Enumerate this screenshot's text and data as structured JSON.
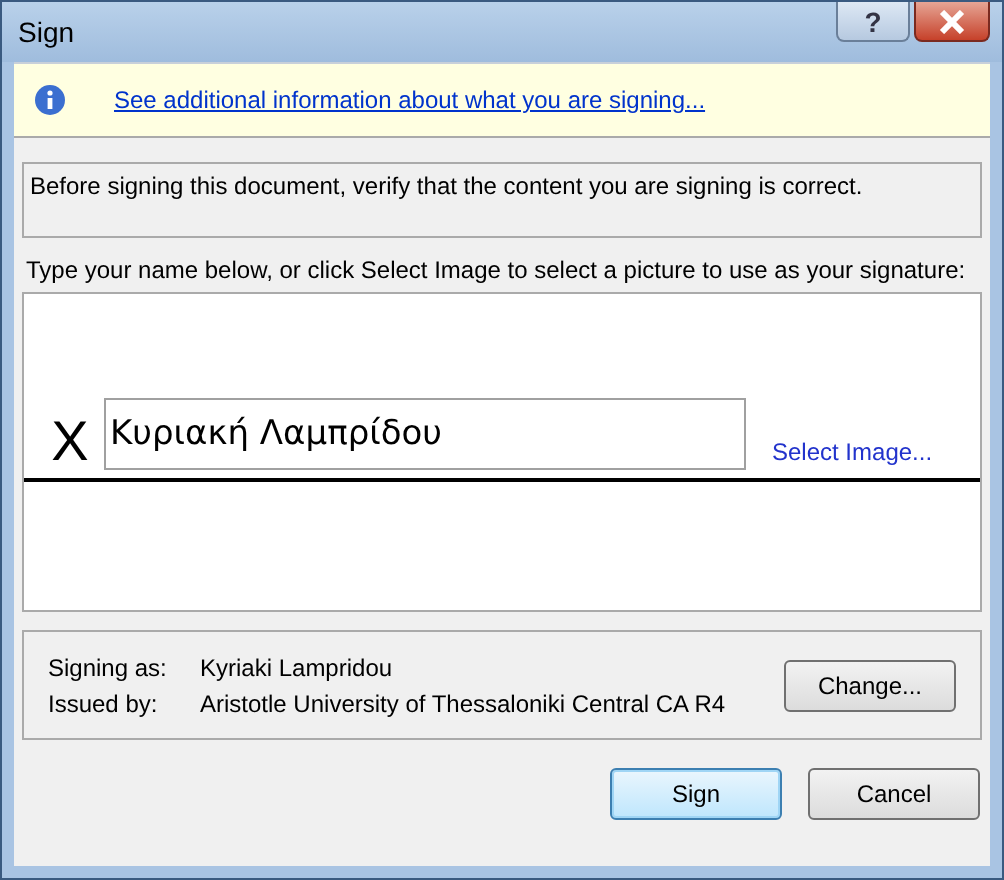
{
  "window": {
    "title": "Sign",
    "help_label": "?"
  },
  "info_bar": {
    "link": "See additional information about what you are signing..."
  },
  "description": "Before signing this document, verify that the content you are signing is correct.",
  "instruction": "Type your name below, or click Select Image to select a picture to use as your signature:",
  "signature": {
    "mark": "X",
    "value": "Κυριακή Λαμπρίδου",
    "select_image_link": "Select Image..."
  },
  "certificate": {
    "rows": [
      {
        "label": "Signing as:",
        "value": "Kyriaki Lampridou"
      },
      {
        "label": "Issued by:",
        "value": "Aristotle University of Thessaloniki Central CA R4"
      }
    ],
    "change_button": "Change..."
  },
  "buttons": [
    {
      "label": "Sign",
      "default": true
    },
    {
      "label": "Cancel",
      "default": false
    }
  ]
}
